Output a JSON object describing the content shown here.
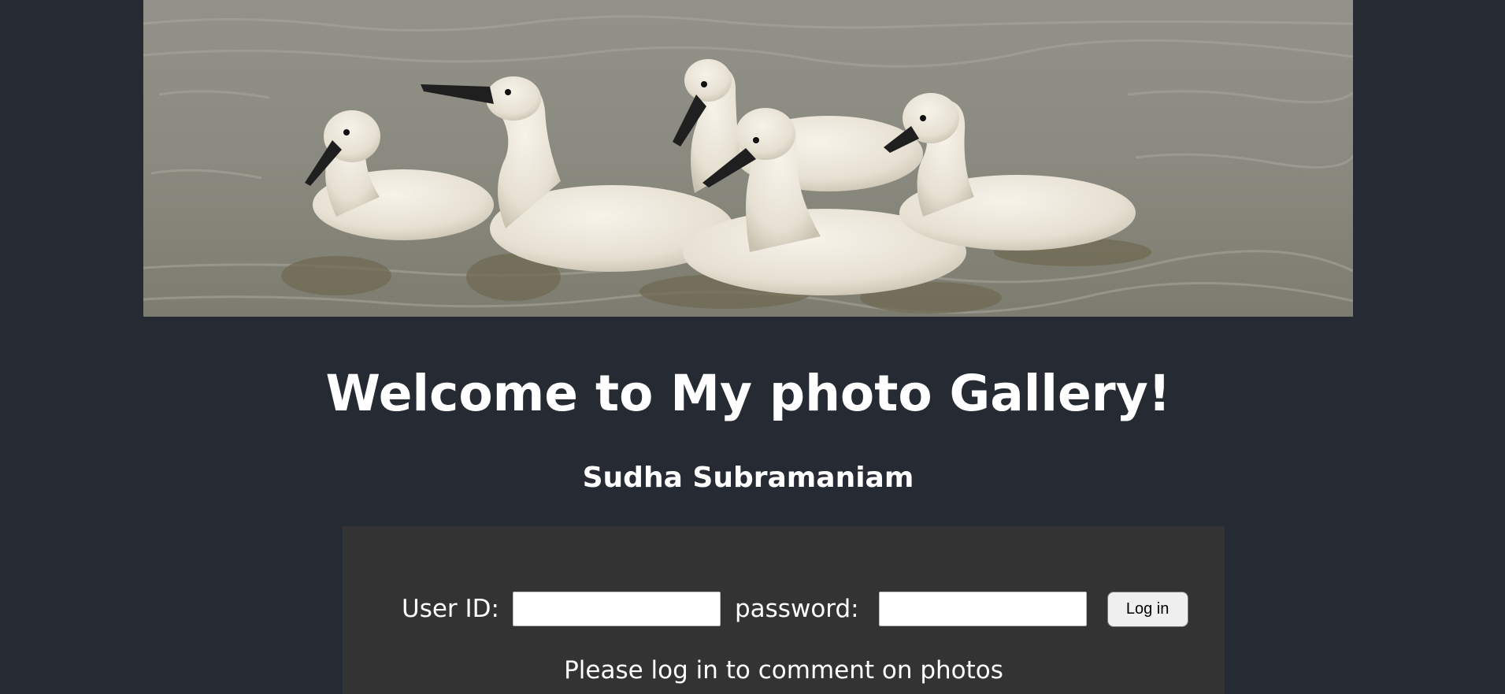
{
  "banner": {
    "alt": "Cygnets swimming",
    "colors": {
      "water": "#8e8d84",
      "cygnet": "#ece7da",
      "beak": "#1f1f1f"
    }
  },
  "header": {
    "title": "Welcome to My photo Gallery!",
    "owner": "Sudha Subramaniam"
  },
  "login": {
    "user_label": "User ID:",
    "user_value": "",
    "password_label": "password:",
    "password_value": "",
    "button_label": "Log in",
    "note": "Please log in to comment on photos"
  },
  "theme": {
    "background": "#262a33",
    "panel": "#333333",
    "text": "#ffffff"
  }
}
